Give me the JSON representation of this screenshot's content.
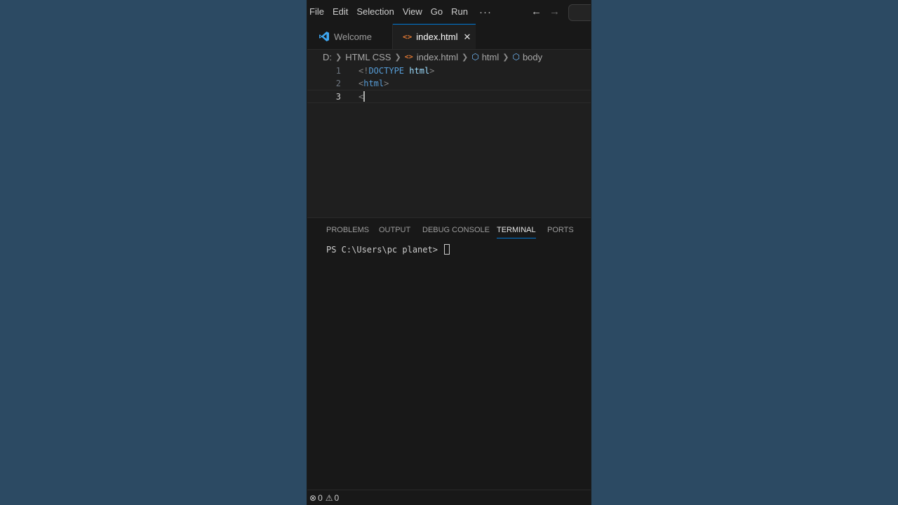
{
  "menu": {
    "items": [
      "File",
      "Edit",
      "Selection",
      "View",
      "Go",
      "Run"
    ],
    "more": "···"
  },
  "nav": {
    "back_icon": "←",
    "forward_icon": "→"
  },
  "tabs": [
    {
      "label": "Welcome",
      "icon": "vscode-logo-icon",
      "active": false
    },
    {
      "label": "index.html",
      "icon": "html-file-icon",
      "active": true,
      "close": "✕"
    }
  ],
  "breadcrumb": {
    "drive": "D:",
    "folder": "HTML CSS",
    "file": "index.html",
    "sym1": "html",
    "sym2": "body"
  },
  "editor": {
    "lines": [
      {
        "number": "1",
        "open": "<!",
        "keyword": "DOCTYPE",
        "space": " ",
        "attr": "html",
        "close": ">"
      },
      {
        "number": "2",
        "open": "<",
        "keyword": "html",
        "close": ">"
      },
      {
        "number": "3",
        "text": "<"
      }
    ]
  },
  "panel": {
    "tabs": [
      "PROBLEMS",
      "OUTPUT",
      "DEBUG CONSOLE",
      "TERMINAL",
      "PORTS"
    ],
    "active_tab": "TERMINAL",
    "terminal_prompt": "PS C:\\Users\\pc planet>"
  },
  "status": {
    "errors": "0",
    "warnings": "0"
  },
  "colors": {
    "accent": "#0078d4",
    "html_icon": "#e37933",
    "keyword": "#569cd6"
  }
}
